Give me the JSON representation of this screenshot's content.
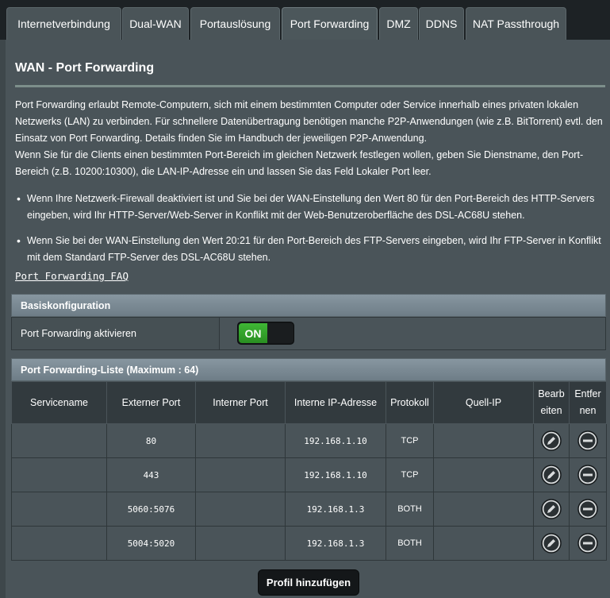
{
  "tabs": [
    {
      "label": "Internetverbindung",
      "active": false
    },
    {
      "label": "Dual-WAN",
      "active": false
    },
    {
      "label": "Portauslösung",
      "active": false
    },
    {
      "label": "Port Forwarding",
      "active": true
    },
    {
      "label": "DMZ",
      "active": false
    },
    {
      "label": "DDNS",
      "active": false
    },
    {
      "label": "NAT Passthrough",
      "active": false
    }
  ],
  "page": {
    "title": "WAN - Port Forwarding",
    "description_1": "Port Forwarding erlaubt Remote-Computern, sich mit einem bestimmten Computer oder Service innerhalb eines privaten lokalen Netzwerks (LAN) zu verbinden. Für schnellere Datenübertragung benötigen manche P2P-Anwendungen (wie z.B. BitTorrent) evtl. den Einsatz von Port Forwarding. Details finden Sie im Handbuch der jeweiligen P2P-Anwendung.",
    "description_2": "Wenn Sie für die Clients einen bestimmten Port-Bereich im gleichen Netzwerk festlegen wollen, geben Sie Dienstname, den Port-Bereich (z.B. 10200:10300), die LAN-IP-Adresse ein und lassen Sie das Feld Lokaler Port leer.",
    "bullet_1": "Wenn Ihre Netzwerk-Firewall deaktiviert ist und Sie bei der WAN-Einstellung den Wert 80 für den Port-Bereich des HTTP-Servers eingeben, wird Ihr HTTP-Server/Web-Server in Konflikt mit der Web-Benutzeroberfläche des DSL-AC68U stehen.",
    "bullet_2": "Wenn Sie bei der WAN-Einstellung den Wert 20:21 für den Port-Bereich des FTP-Servers eingeben, wird Ihr FTP-Server in Konflikt mit dem Standard FTP-Server des DSL-AC68U stehen.",
    "faq_link": "Port Forwarding FAQ"
  },
  "basic_config": {
    "header": "Basiskonfiguration",
    "enable_label": "Port Forwarding aktivieren",
    "toggle_value": "ON"
  },
  "list": {
    "header": "Port Forwarding-Liste (Maximum : 64)",
    "columns": {
      "service": "Servicename",
      "ext_port": "Externer Port",
      "int_port": "Interner Port",
      "ip": "Interne IP-Adresse",
      "proto": "Protokoll",
      "src_ip": "Quell-IP",
      "edit_1": "Bearb",
      "edit_2": "eiten",
      "del_1": "Entfer",
      "del_2": "nen"
    },
    "rows": [
      {
        "service": "",
        "ext_port": "80",
        "int_port": "",
        "ip": "192.168.1.10",
        "proto": "TCP",
        "src_ip": ""
      },
      {
        "service": "",
        "ext_port": "443",
        "int_port": "",
        "ip": "192.168.1.10",
        "proto": "TCP",
        "src_ip": ""
      },
      {
        "service": "",
        "ext_port": "5060:5076",
        "int_port": "",
        "ip": "192.168.1.3",
        "proto": "BOTH",
        "src_ip": ""
      },
      {
        "service": "",
        "ext_port": "5004:5020",
        "int_port": "",
        "ip": "192.168.1.3",
        "proto": "BOTH",
        "src_ip": ""
      }
    ],
    "add_button": "Profil hinzufügen"
  }
}
